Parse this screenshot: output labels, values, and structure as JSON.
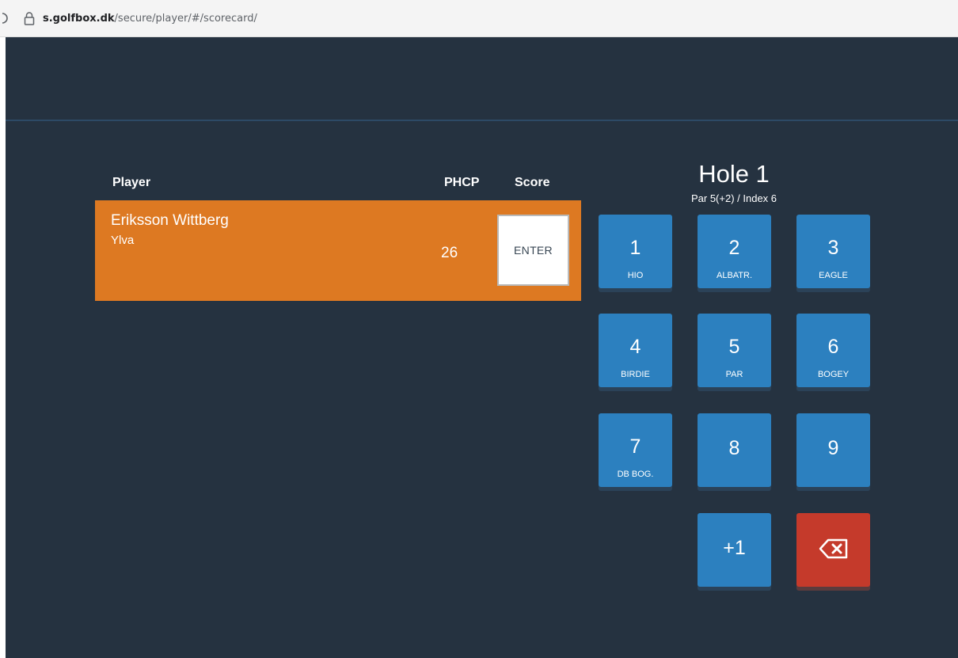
{
  "browser": {
    "url_host": "s.golfbox.dk",
    "url_path": "/secure/player/#/scorecard/"
  },
  "table": {
    "headers": {
      "player": "Player",
      "phcp": "PHCP",
      "score": "Score"
    },
    "players": [
      {
        "last_name": "Eriksson Wittberg",
        "first_name": "Ylva",
        "phcp": "26",
        "score_label": "ENTER"
      }
    ]
  },
  "hole": {
    "title": "Hole 1",
    "subtitle": "Par 5(+2) / Index 6"
  },
  "keypad": {
    "keys": [
      {
        "num": "1",
        "label": "HIO"
      },
      {
        "num": "2",
        "label": "ALBATR."
      },
      {
        "num": "3",
        "label": "EAGLE"
      },
      {
        "num": "4",
        "label": "BIRDIE"
      },
      {
        "num": "5",
        "label": "PAR"
      },
      {
        "num": "6",
        "label": "BOGEY"
      },
      {
        "num": "7",
        "label": "DB BOG."
      },
      {
        "num": "8",
        "label": ""
      },
      {
        "num": "9",
        "label": ""
      }
    ],
    "plus_one": "+1",
    "delete_icon": "backspace-icon"
  },
  "colors": {
    "background": "#253240",
    "row_orange": "#dd7922",
    "key_blue": "#2c80bf",
    "key_red": "#c53a2b"
  }
}
